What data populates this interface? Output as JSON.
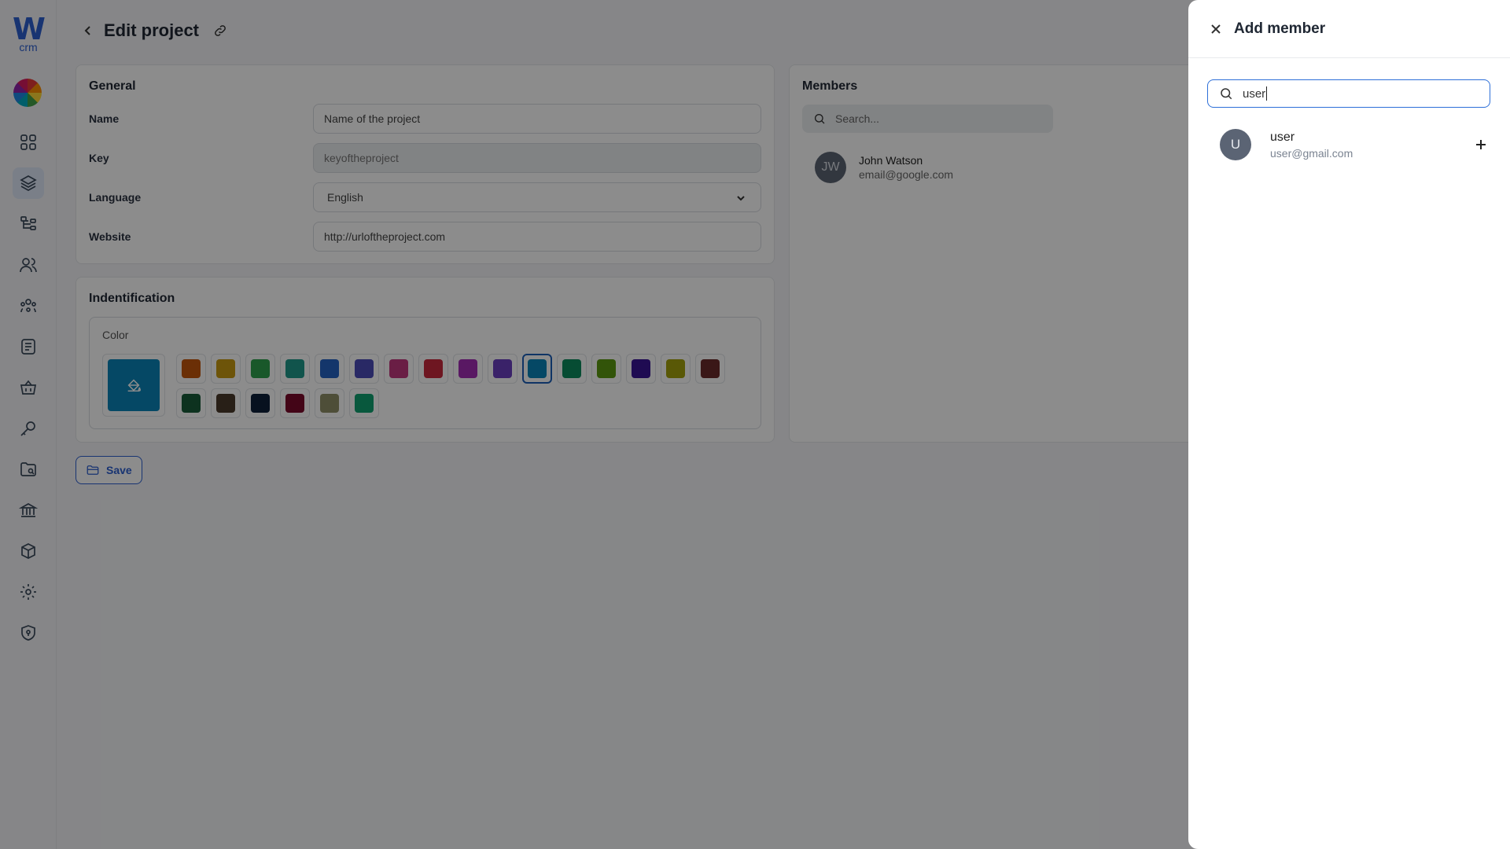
{
  "app": {
    "logo_letter": "W",
    "logo_sub": "crm"
  },
  "sidebar": {
    "items": [
      {
        "icon": "dashboard-grid-icon"
      },
      {
        "icon": "layers-icon",
        "active": true
      },
      {
        "icon": "hierarchy-icon"
      },
      {
        "icon": "users-icon"
      },
      {
        "icon": "team-icon"
      },
      {
        "icon": "notes-icon"
      },
      {
        "icon": "basket-icon"
      },
      {
        "icon": "key-icon"
      },
      {
        "icon": "folder-search-icon"
      },
      {
        "icon": "bank-icon"
      },
      {
        "icon": "box-icon"
      },
      {
        "icon": "settings-icon"
      },
      {
        "icon": "shield-icon"
      }
    ]
  },
  "page": {
    "title": "Edit project"
  },
  "general": {
    "title": "General",
    "name_label": "Name",
    "name_value": "Name of the project",
    "key_label": "Key",
    "key_value": "keyoftheproject",
    "language_label": "Language",
    "language_value": "English",
    "website_label": "Website",
    "website_value": "http://urloftheproject.com"
  },
  "identification": {
    "title": "Indentification",
    "color_label": "Color",
    "selected_color": "#0a84b8",
    "colors": [
      "#c4560c",
      "#c79a12",
      "#2ea04d",
      "#1f9a8a",
      "#2563c4",
      "#4b4bb8",
      "#c2377f",
      "#c8283d",
      "#a32cb4",
      "#6a3fc0",
      "#0a84b8",
      "#0c8a5e",
      "#5c9a12",
      "#3a1496",
      "#a3a00c",
      "#6b2b2b",
      "#185c3a",
      "#4a3a2a",
      "#0d1f3a",
      "#7a0a2a",
      "#8f8f66",
      "#10a070"
    ],
    "selected_index": 10
  },
  "actions": {
    "save_label": "Save"
  },
  "members": {
    "title": "Members",
    "search_placeholder": "Search...",
    "list": [
      {
        "initials": "JW",
        "name": "John Watson",
        "email": "email@google.com"
      }
    ]
  },
  "drawer": {
    "title": "Add member",
    "search_value": "user",
    "results": [
      {
        "initial": "U",
        "name": "user",
        "email": "user@gmail.com"
      }
    ]
  },
  "colors": {
    "accent": "#2d5fd0"
  }
}
